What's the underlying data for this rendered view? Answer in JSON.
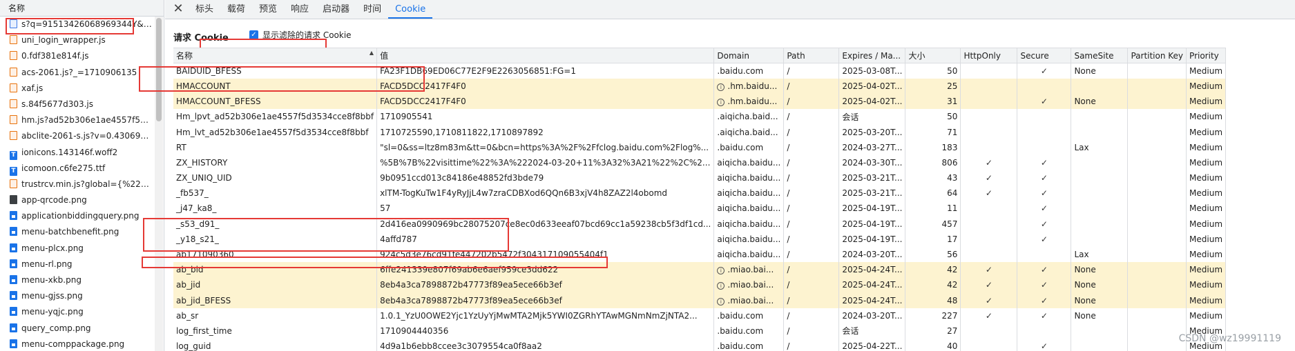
{
  "left_panel": {
    "header": "名称",
    "requests": [
      {
        "name": "s?q=91513426068969344Y&t...",
        "type": "doc"
      },
      {
        "name": "uni_login_wrapper.js",
        "type": "script"
      },
      {
        "name": "0.fdf381e814f.js",
        "type": "script"
      },
      {
        "name": "acs-2061.js?_=1710906135",
        "type": "script"
      },
      {
        "name": "xaf.js",
        "type": "script"
      },
      {
        "name": "s.84f5677d303.js",
        "type": "script"
      },
      {
        "name": "hm.js?ad52b306e1ae4557f5d...",
        "type": "script"
      },
      {
        "name": "abclite-2061-s.js?v=0.4306914...",
        "type": "script"
      },
      {
        "name": "ionicons.143146f.woff2",
        "type": "font"
      },
      {
        "name": "icomoon.c6fe275.ttf",
        "type": "font"
      },
      {
        "name": "trustrcv.min.js?global={%22co...",
        "type": "script"
      },
      {
        "name": "app-qrcode.png",
        "type": "dark"
      },
      {
        "name": "applicationbiddingquery.png",
        "type": "img"
      },
      {
        "name": "menu-batchbenefit.png",
        "type": "img"
      },
      {
        "name": "menu-plcx.png",
        "type": "img"
      },
      {
        "name": "menu-rl.png",
        "type": "img"
      },
      {
        "name": "menu-xkb.png",
        "type": "img"
      },
      {
        "name": "menu-gjss.png",
        "type": "img"
      },
      {
        "name": "menu-yqjc.png",
        "type": "img"
      },
      {
        "name": "query_comp.png",
        "type": "img"
      },
      {
        "name": "menu-comppackage.png",
        "type": "img"
      }
    ]
  },
  "tabs": [
    "标头",
    "载荷",
    "预览",
    "响应",
    "启动器",
    "时间",
    "Cookie"
  ],
  "active_tab": "Cookie",
  "section_title": "请求 Cookie",
  "filter_checkbox_label": "显示滤除的请求 Cookie",
  "columns": [
    "名称",
    "值",
    "Domain",
    "Path",
    "Expires / Ma...",
    "大小",
    "HttpOnly",
    "Secure",
    "SameSite",
    "Partition Key",
    "Priority"
  ],
  "cookies": [
    {
      "name": "BAIDUID_BFESS",
      "value": "FA23F1DB69ED06C77E2F9E2263056851:FG=1",
      "domain": ".baidu.com",
      "info": false,
      "path": "/",
      "expires": "2025-03-08T...",
      "size": "50",
      "httponly": "",
      "secure": "✓",
      "samesite": "None",
      "partition": "",
      "priority": "Medium",
      "hl": false
    },
    {
      "name": "HMACCOUNT",
      "value": "FACD5DCC2417F4F0",
      "domain": ".hm.baidu...",
      "info": true,
      "path": "/",
      "expires": "2025-04-02T...",
      "size": "25",
      "httponly": "",
      "secure": "",
      "samesite": "",
      "partition": "",
      "priority": "Medium",
      "hl": true
    },
    {
      "name": "HMACCOUNT_BFESS",
      "value": "FACD5DCC2417F4F0",
      "domain": ".hm.baidu...",
      "info": true,
      "path": "/",
      "expires": "2025-04-02T...",
      "size": "31",
      "httponly": "",
      "secure": "✓",
      "samesite": "None",
      "partition": "",
      "priority": "Medium",
      "hl": true
    },
    {
      "name": "Hm_lpvt_ad52b306e1ae4557f5d3534cce8f8bbf",
      "value": "1710905541",
      "domain": ".aiqicha.baid...",
      "info": false,
      "path": "/",
      "expires": "会话",
      "size": "50",
      "httponly": "",
      "secure": "",
      "samesite": "",
      "partition": "",
      "priority": "Medium",
      "hl": false
    },
    {
      "name": "Hm_lvt_ad52b306e1ae4557f5d3534cce8f8bbf",
      "value": "1710725590,1710811822,1710897892",
      "domain": ".aiqicha.baid...",
      "info": false,
      "path": "/",
      "expires": "2025-03-20T...",
      "size": "71",
      "httponly": "",
      "secure": "",
      "samesite": "",
      "partition": "",
      "priority": "Medium",
      "hl": false
    },
    {
      "name": "RT",
      "value": "\"sl=0&ss=ltz8m83m&tt=0&bcn=https%3A%2F%2Ffclog.baidu.com%2Flog%...",
      "domain": ".baidu.com",
      "info": false,
      "path": "/",
      "expires": "2024-03-27T...",
      "size": "183",
      "httponly": "",
      "secure": "",
      "samesite": "Lax",
      "partition": "",
      "priority": "Medium",
      "hl": false
    },
    {
      "name": "ZX_HISTORY",
      "value": "%5B%7B%22visittime%22%3A%222024-03-20+11%3A32%3A21%22%2C%2...",
      "domain": "aiqicha.baidu...",
      "info": false,
      "path": "/",
      "expires": "2024-03-30T...",
      "size": "806",
      "httponly": "✓",
      "secure": "✓",
      "samesite": "",
      "partition": "",
      "priority": "Medium",
      "hl": false
    },
    {
      "name": "ZX_UNIQ_UID",
      "value": "9b0951ccd013c84186e48852fd3bde79",
      "domain": "aiqicha.baidu...",
      "info": false,
      "path": "/",
      "expires": "2025-03-21T...",
      "size": "43",
      "httponly": "✓",
      "secure": "✓",
      "samesite": "",
      "partition": "",
      "priority": "Medium",
      "hl": false
    },
    {
      "name": "_fb537_",
      "value": "xlTM-TogKuTw1F4yRyJjL4w7zraCDBXod6QQn6B3xjV4h8ZAZ2l4obomd",
      "domain": "aiqicha.baidu...",
      "info": false,
      "path": "/",
      "expires": "2025-03-21T...",
      "size": "64",
      "httponly": "✓",
      "secure": "✓",
      "samesite": "",
      "partition": "",
      "priority": "Medium",
      "hl": false
    },
    {
      "name": "_j47_ka8_",
      "value": "57",
      "domain": "aiqicha.baidu...",
      "info": false,
      "path": "/",
      "expires": "2025-04-19T...",
      "size": "11",
      "httponly": "",
      "secure": "✓",
      "samesite": "",
      "partition": "",
      "priority": "Medium",
      "hl": false
    },
    {
      "name": "_s53_d91_",
      "value": "2d416ea0990969bc28075207ce8ec0d633eeaf07bcd69cc1a59238cb5f3df1cd...",
      "domain": "aiqicha.baidu...",
      "info": false,
      "path": "/",
      "expires": "2025-04-19T...",
      "size": "457",
      "httponly": "",
      "secure": "✓",
      "samesite": "",
      "partition": "",
      "priority": "Medium",
      "hl": false
    },
    {
      "name": "_y18_s21_",
      "value": "4affd787",
      "domain": "aiqicha.baidu...",
      "info": false,
      "path": "/",
      "expires": "2025-04-19T...",
      "size": "17",
      "httponly": "",
      "secure": "✓",
      "samesite": "",
      "partition": "",
      "priority": "Medium",
      "hl": false
    },
    {
      "name": "ab171090360",
      "value": "924c5d3e76cd91fe447202b5472f304317109055404f1",
      "domain": "aiqicha.baidu...",
      "info": false,
      "path": "/",
      "expires": "2024-03-20T...",
      "size": "56",
      "httponly": "",
      "secure": "",
      "samesite": "Lax",
      "partition": "",
      "priority": "Medium",
      "hl": false
    },
    {
      "name": "ab_bid",
      "value": "6ffe241339e807f69ab6e6aef959ce3dd622",
      "domain": ".miao.bai...",
      "info": true,
      "path": "/",
      "expires": "2025-04-24T...",
      "size": "42",
      "httponly": "✓",
      "secure": "✓",
      "samesite": "None",
      "partition": "",
      "priority": "Medium",
      "hl": true
    },
    {
      "name": "ab_jid",
      "value": "8eb4a3ca7898872b47773f89ea5ece66b3ef",
      "domain": ".miao.bai...",
      "info": true,
      "path": "/",
      "expires": "2025-04-24T...",
      "size": "42",
      "httponly": "✓",
      "secure": "✓",
      "samesite": "None",
      "partition": "",
      "priority": "Medium",
      "hl": true
    },
    {
      "name": "ab_jid_BFESS",
      "value": "8eb4a3ca7898872b47773f89ea5ece66b3ef",
      "domain": ".miao.bai...",
      "info": true,
      "path": "/",
      "expires": "2025-04-24T...",
      "size": "48",
      "httponly": "✓",
      "secure": "✓",
      "samesite": "None",
      "partition": "",
      "priority": "Medium",
      "hl": true
    },
    {
      "name": "ab_sr",
      "value": "1.0.1_YzU0OWE2Yjc1YzUyYjMwMTA2Mjk5YWI0ZGRhYTAwMGNmNmZjNTA2...",
      "domain": ".baidu.com",
      "info": false,
      "path": "/",
      "expires": "2024-03-20T...",
      "size": "227",
      "httponly": "✓",
      "secure": "✓",
      "samesite": "None",
      "partition": "",
      "priority": "Medium",
      "hl": false
    },
    {
      "name": "log_first_time",
      "value": "1710904440356",
      "domain": ".baidu.com",
      "info": false,
      "path": "/",
      "expires": "会话",
      "size": "27",
      "httponly": "",
      "secure": "",
      "samesite": "",
      "partition": "",
      "priority": "Medium",
      "hl": false
    },
    {
      "name": "log_guid",
      "value": "4d9a1b6ebb8ccee3c3079554ca0f8aa2",
      "domain": ".baidu.com",
      "info": false,
      "path": "/",
      "expires": "2025-04-22T...",
      "size": "40",
      "httponly": "",
      "secure": "✓",
      "samesite": "",
      "partition": "",
      "priority": "Medium",
      "hl": false
    }
  ],
  "watermark": "CSDN @wz19991119",
  "colors": {
    "accent": "#1a73e8",
    "highlight": "#fdf3d0",
    "annotation": "#e53935"
  }
}
